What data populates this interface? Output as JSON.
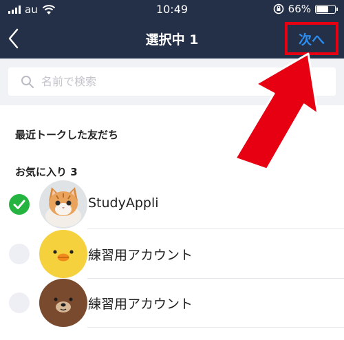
{
  "status_bar": {
    "carrier": "au",
    "time": "10:49",
    "battery_percent": "66%",
    "battery_level": 0.66
  },
  "nav": {
    "title": "選択中 1",
    "next_label": "次へ"
  },
  "search": {
    "placeholder": "名前で検索"
  },
  "sections": {
    "recent": "最近トークした友だち",
    "favorites": "お気に入り 3"
  },
  "friends": [
    {
      "name": "StudyAppli",
      "selected": true
    },
    {
      "name": "練習用アカウント",
      "selected": false
    },
    {
      "name": "練習用アカウント",
      "selected": false
    }
  ],
  "colors": {
    "header_bg": "#243047",
    "accent_blue": "#2c8ef0",
    "check_green": "#25b440",
    "highlight_red": "#e60012"
  }
}
